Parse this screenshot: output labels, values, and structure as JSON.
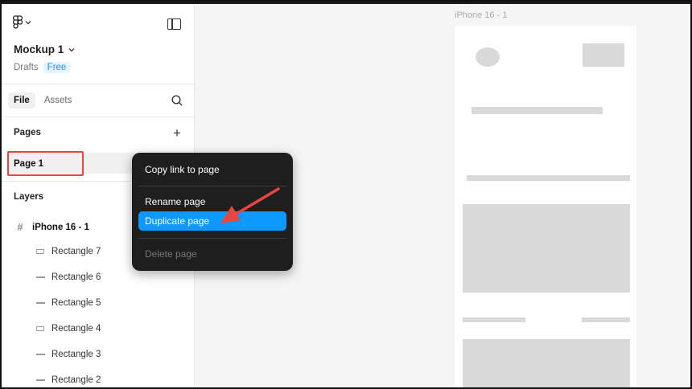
{
  "file": {
    "title": "Mockup 1",
    "location": "Drafts",
    "plan": "Free"
  },
  "tabs": [
    {
      "label": "File"
    },
    {
      "label": "Assets"
    }
  ],
  "pages": {
    "title": "Pages",
    "items": [
      {
        "label": "Page 1"
      }
    ]
  },
  "layers": {
    "title": "Layers",
    "frame": {
      "label": "iPhone 16 - 1",
      "icon": "frame-hash-icon"
    },
    "items": [
      {
        "label": "Rectangle 7",
        "icon": "rectangle-icon"
      },
      {
        "label": "Rectangle 6",
        "icon": "line-icon"
      },
      {
        "label": "Rectangle 5",
        "icon": "line-icon"
      },
      {
        "label": "Rectangle 4",
        "icon": "rectangle-icon"
      },
      {
        "label": "Rectangle 3",
        "icon": "line-icon"
      },
      {
        "label": "Rectangle 2",
        "icon": "line-icon"
      }
    ]
  },
  "canvas": {
    "frame_label": "iPhone 16 - 1"
  },
  "context_menu": {
    "items": [
      {
        "label": "Copy link to page"
      },
      {
        "label": "Rename page"
      },
      {
        "label": "Duplicate page",
        "state": "highlighted"
      },
      {
        "label": "Delete page",
        "state": "disabled"
      }
    ]
  },
  "colors": {
    "accent": "#0d99ff",
    "annotation": "#e5483d",
    "menu_bg": "#1e1e1e"
  }
}
